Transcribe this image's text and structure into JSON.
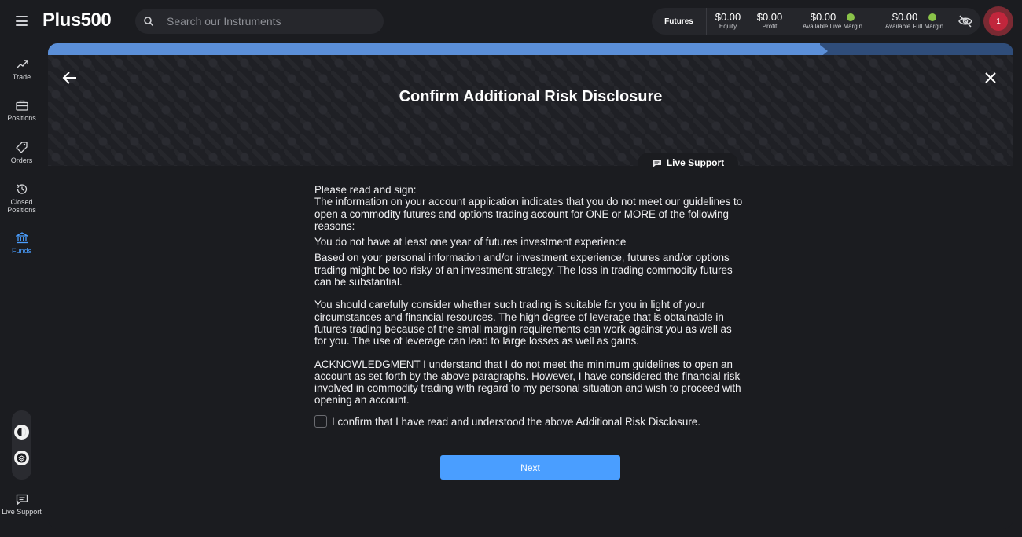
{
  "header": {
    "logo": "Plus500",
    "search_placeholder": "Search our Instruments",
    "futures_label": "Futures",
    "stats": [
      {
        "value": "$0.00",
        "label": "Equity"
      },
      {
        "value": "$0.00",
        "label": "Profit"
      },
      {
        "value": "$0.00",
        "label": "Available Live Margin"
      },
      {
        "value": "$0.00",
        "label": "Available Full Margin"
      }
    ],
    "avatar_initial": "1"
  },
  "sidebar": {
    "items": [
      {
        "label": "Trade",
        "icon": "trend-up-icon"
      },
      {
        "label": "Positions",
        "icon": "briefcase-icon"
      },
      {
        "label": "Orders",
        "icon": "tag-icon"
      },
      {
        "label": "Closed Positions",
        "icon": "history-icon"
      },
      {
        "label": "Funds",
        "icon": "bank-icon"
      },
      {
        "label": "Live Support",
        "icon": "chat-icon"
      }
    ]
  },
  "progress": {
    "fraction": 0.8
  },
  "modal": {
    "title": "Confirm Additional Risk Disclosure",
    "live_support": "Live Support",
    "intro": "Please read and sign:",
    "p1": "The information on your account application indicates that you do not meet our guidelines to open a commodity futures and options trading account for ONE or MORE of the following reasons:",
    "p2": "You do not have at least one year of futures investment experience",
    "p3": "Based on your personal information and/or investment experience, futures and/or options trading might be too risky of an investment strategy. The loss in trading commodity futures can be substantial.",
    "p4": "You should carefully consider whether such trading is suitable for you in light of your circumstances and financial resources. The high degree of leverage that is obtainable in futures trading because of the small margin requirements can work against you as well as for you. The use of leverage can lead to large losses as well as gains.",
    "p5": "ACKNOWLEDGMENT I understand that I do not meet the minimum guidelines to open an account as set forth by the above paragraphs. However, I have considered the financial risk involved in commodity trading with regard to my personal situation and wish to proceed with opening an account.",
    "confirm_label": "I confirm that I have read and understood the above Additional Risk Disclosure.",
    "next_label": "Next"
  },
  "colors": {
    "accent": "#4a9eff",
    "background": "#1b1c20",
    "status_ok": "#8ac349",
    "avatar": "#c1263c"
  }
}
